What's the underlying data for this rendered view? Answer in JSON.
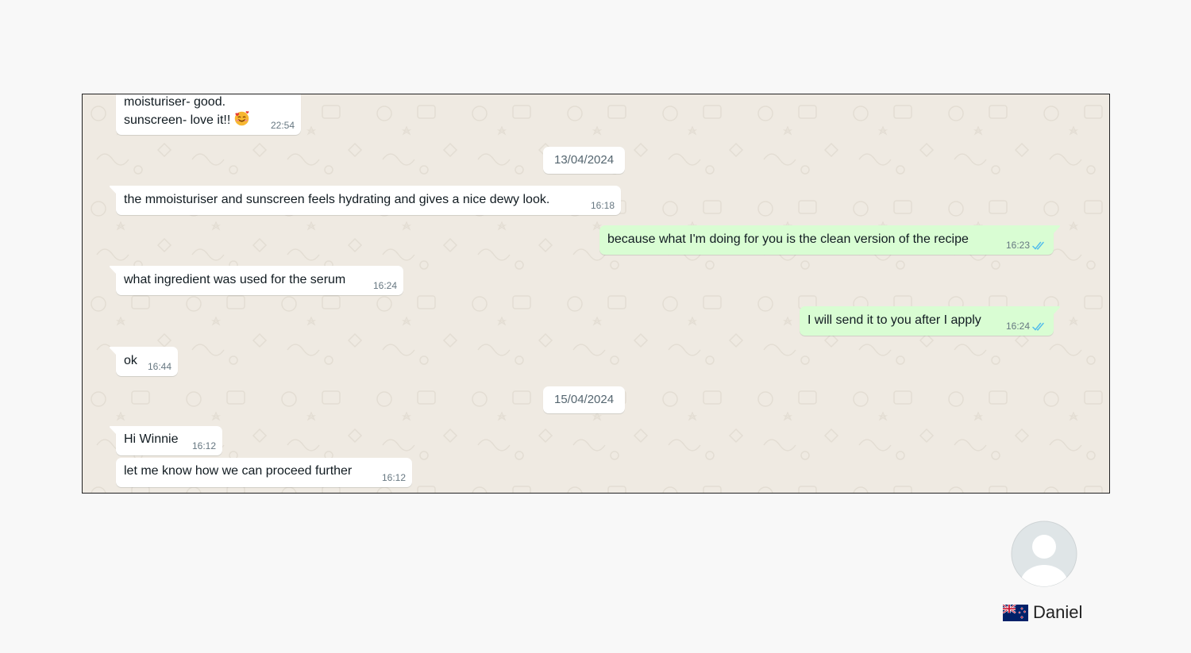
{
  "messages": [
    {
      "direction": "in",
      "lines": [
        "moisturiser- good.",
        "sunscreen- love it!!"
      ],
      "emoji": "smiling-face-with-hearts",
      "time": "22:54"
    },
    {
      "direction": "date",
      "text": "13/04/2024"
    },
    {
      "direction": "in",
      "text": "the mmoisturiser and sunscreen feels hydrating and gives a nice dewy look.",
      "time": "16:18"
    },
    {
      "direction": "out",
      "text": "because what I'm doing for you is the clean version of the recipe",
      "time": "16:23",
      "status": "read"
    },
    {
      "direction": "in",
      "text": "what ingredient was used for the serum",
      "time": "16:24"
    },
    {
      "direction": "out",
      "text": "I will send it to you after I apply",
      "time": "16:24",
      "status": "read"
    },
    {
      "direction": "in",
      "text": "ok",
      "time": "16:44"
    },
    {
      "direction": "date",
      "text": "15/04/2024"
    },
    {
      "direction": "in",
      "text": "Hi Winnie",
      "time": "16:12"
    },
    {
      "direction": "in",
      "text": "let me know how we can proceed further",
      "time": "16:12"
    }
  ],
  "contact": {
    "name": "Daniel",
    "flag_icon": "new-zealand-flag-icon",
    "avatar_icon": "default-avatar-icon"
  },
  "colors": {
    "incoming_bubble": "#ffffff",
    "outgoing_bubble": "#d9fdd3",
    "chat_background": "#efeae2",
    "read_tick": "#53bdeb",
    "timestamp": "#667781"
  }
}
